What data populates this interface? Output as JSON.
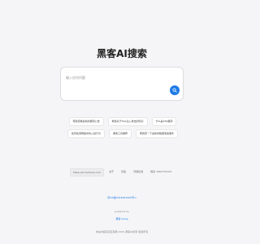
{
  "header": {
    "title": "黑客AI搜索"
  },
  "search": {
    "placeholder": "输入任何问题",
    "button_icon": "search-icon",
    "accent_color": "#1e7be6"
  },
  "suggestions": [
    "帮我查看最新的漏洞公告",
    "教我关于SQL注入攻击的知识",
    "什么是XSS漏洞",
    "如何检测网络中的入侵行为",
    "黑客工具推荐",
    "帮我查一下最新的数据泄露事件"
  ],
  "links": {
    "domain": "https://ai.hackerai.com",
    "about": "关于",
    "privacy": "隐私",
    "support": "问题反馈",
    "contact": "联系 1952731313"
  },
  "footer": {
    "icp": "京ICP备2024081605号-1",
    "powered": "powered by",
    "brand": "黑客 wang",
    "copyright": "本站内容来自互联网 2024 黑客AI搜索 版权所有"
  }
}
